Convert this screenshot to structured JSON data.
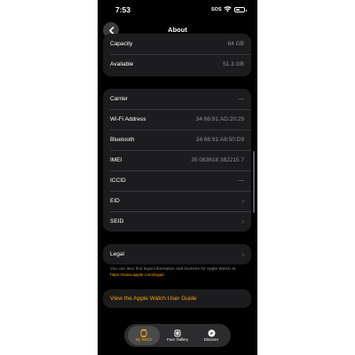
{
  "status_bar": {
    "time": "7:53",
    "sos": "SOS"
  },
  "nav": {
    "title": "About"
  },
  "storage": [
    {
      "label": "Capacity",
      "value": "64 GB"
    },
    {
      "label": "Available",
      "value": "51.3 GB"
    }
  ],
  "device": [
    {
      "label": "Carrier",
      "value": "—"
    },
    {
      "label": "Wi-Fi Address",
      "value": "34:66:91:AD:20:29"
    },
    {
      "label": "Bluetooth",
      "value": "34:66:91:A8:50:D9"
    },
    {
      "label": "IMEI",
      "value": "35 083618 382215 7"
    },
    {
      "label": "ICCID",
      "value": "—"
    },
    {
      "label": "EID",
      "value": ""
    },
    {
      "label": "SEID",
      "value": ""
    }
  ],
  "legal": {
    "label": "Legal",
    "footnote": "You can also find legal information and licenses for Apple Watch at ",
    "footnote_link": "https://www.apple.com/legal/",
    "footnote_end": "."
  },
  "guide": {
    "label": "View the Apple Watch User Guide"
  },
  "tabs": [
    {
      "label": "My Watch",
      "icon": "watch-icon"
    },
    {
      "label": "Face Gallery",
      "icon": "face-gallery-icon"
    },
    {
      "label": "Discover",
      "icon": "compass-icon"
    }
  ],
  "colors": {
    "accent": "#ff9f0a",
    "background": "#000000",
    "card": "#1c1c1e",
    "secondary_text": "#8e8e93"
  }
}
